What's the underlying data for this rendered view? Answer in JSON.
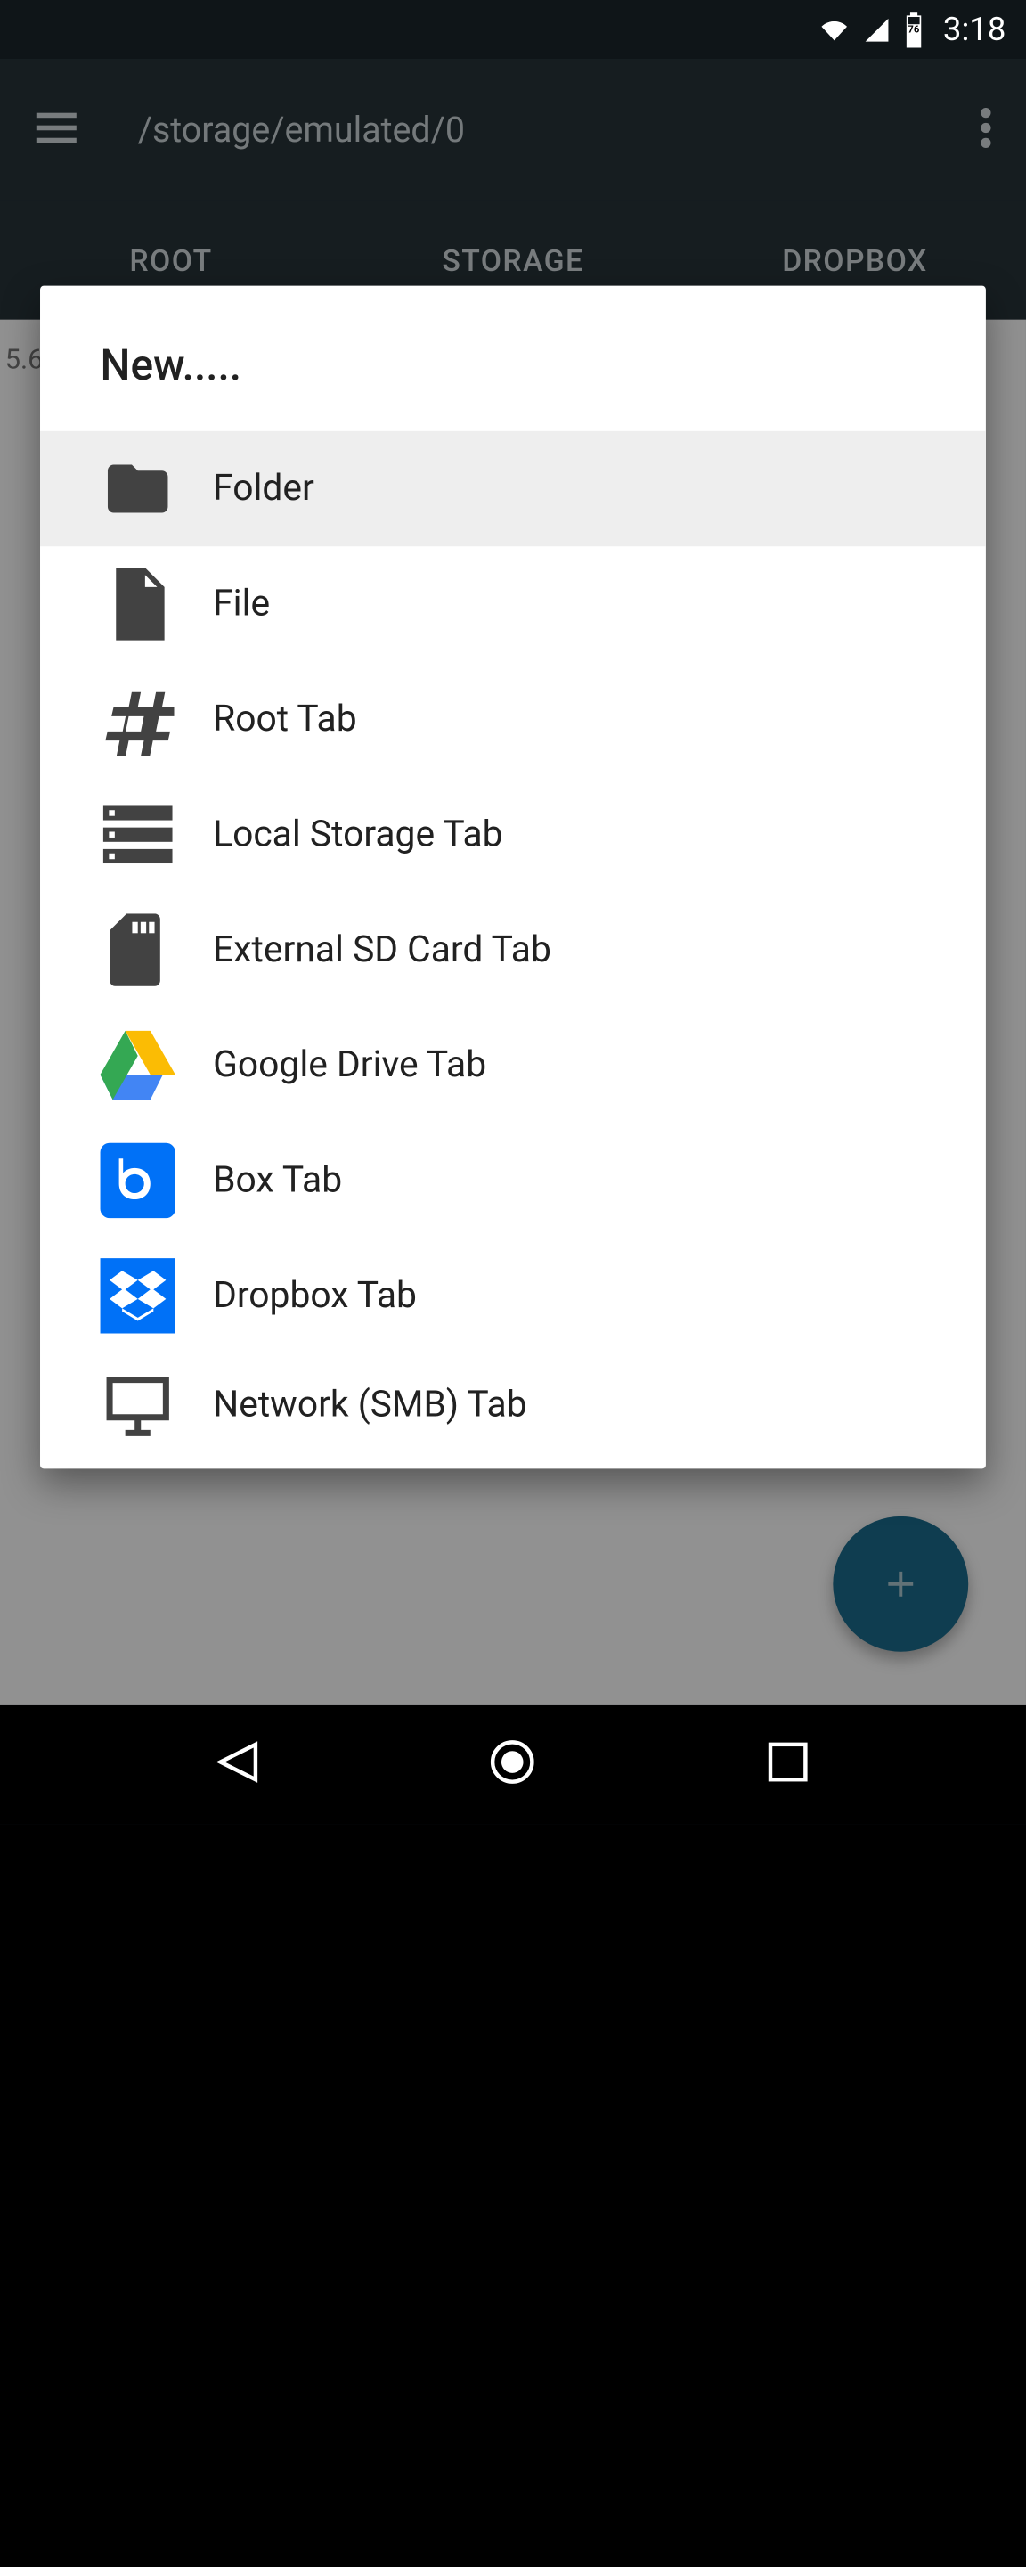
{
  "status": {
    "battery_level": "76",
    "time": "3:18"
  },
  "app_bar": {
    "path": "/storage/emulated/0"
  },
  "tabs": [
    {
      "label": "ROOT"
    },
    {
      "label": "STORAGE"
    },
    {
      "label": "DROPBOX"
    }
  ],
  "content": {
    "visible_text": "5.6"
  },
  "dialog": {
    "title": "New.....",
    "items": [
      {
        "icon": "folder-icon",
        "label": "Folder",
        "selected": true
      },
      {
        "icon": "file-icon",
        "label": "File",
        "selected": false
      },
      {
        "icon": "hash-icon",
        "label": "Root Tab",
        "selected": false
      },
      {
        "icon": "storage-icon",
        "label": "Local Storage Tab",
        "selected": false
      },
      {
        "icon": "sd-card-icon",
        "label": "External SD Card Tab",
        "selected": false
      },
      {
        "icon": "google-drive-icon",
        "label": "Google Drive Tab",
        "selected": false
      },
      {
        "icon": "box-icon",
        "label": "Box Tab",
        "selected": false
      },
      {
        "icon": "dropbox-icon",
        "label": "Dropbox Tab",
        "selected": false
      },
      {
        "icon": "network-icon",
        "label": "Network (SMB) Tab",
        "selected": false
      }
    ]
  }
}
